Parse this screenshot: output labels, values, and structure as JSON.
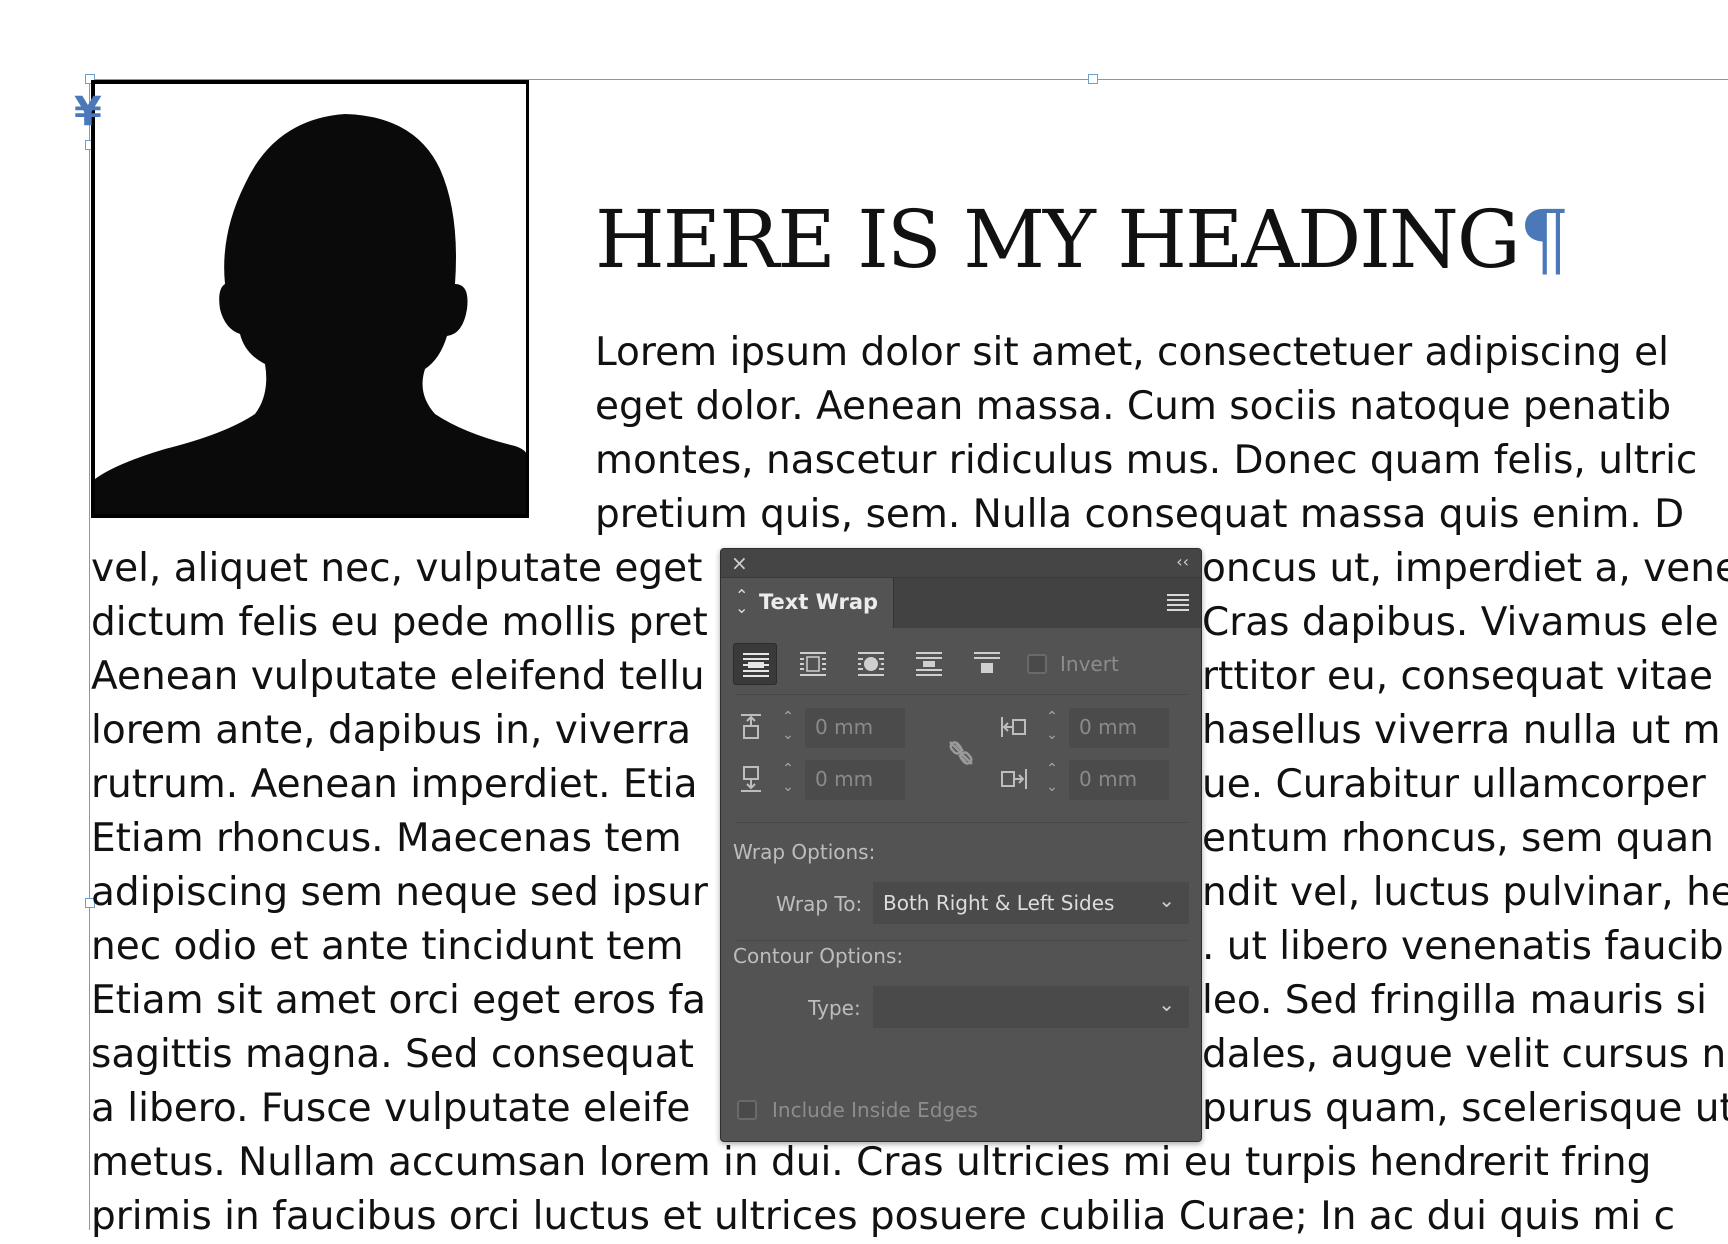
{
  "document": {
    "heading": "HERE IS MY HEADING",
    "pilcrow": "¶",
    "anchor_marker": "¥",
    "lines": [
      "Lorem ipsum dolor sit amet, consectetuer adipiscing el",
      "eget dolor. Aenean massa. Cum sociis natoque penatib",
      "montes, nascetur ridiculus mus. Donec quam felis, ultric",
      "pretium quis, sem. Nulla consequat massa quis enim. D",
      "vel, aliquet nec, vulputate eget",
      "dictum felis eu pede mollis pret",
      "Aenean vulputate eleifend tellu",
      "lorem ante, dapibus in, viverra",
      "rutrum. Aenean imperdiet. Etia",
      "Etiam rhoncus. Maecenas tem",
      "adipiscing sem neque sed ipsur",
      "nec odio et ante tincidunt tem",
      "Etiam sit amet orci eget eros fa",
      "sagittis magna. Sed consequat",
      "a libero. Fusce vulputate eleife",
      "metus. Nullam accumsan lorem in dui. Cras ultricies mi eu turpis hendrerit fring",
      "primis in faucibus orci luctus et ultrices posuere cubilia Curae; In ac dui quis mi c"
    ],
    "right_fragments": [
      "oncus ut, imperdiet a, vene",
      "Cras dapibus. Vivamus ele",
      "rttitor eu, consequat vitae",
      "hasellus viverra nulla ut m",
      "ue. Curabitur ullamcorper",
      "entum rhoncus, sem quan",
      "ndit vel, luctus pulvinar, he",
      ". ut libero venenatis faucib",
      "leo. Sed fringilla mauris si",
      "dales, augue velit cursus n",
      "purus quam, scelerisque ut"
    ]
  },
  "panel": {
    "title": "Text Wrap",
    "close_glyph": "×",
    "collapse_glyph": "‹‹",
    "invert_label": "Invert",
    "offsets": {
      "top": "0 mm",
      "bottom": "0 mm",
      "left": "0 mm",
      "right": "0 mm"
    },
    "wrap_options_label": "Wrap Options:",
    "wrap_to_label": "Wrap To:",
    "wrap_to_value": "Both Right & Left Sides",
    "contour_options_label": "Contour Options:",
    "type_label": "Type:",
    "type_value": "",
    "include_inside_edges_label": "Include Inside Edges",
    "stepper_up": "⌃",
    "stepper_down": "⌄",
    "chevron": "⌄"
  }
}
